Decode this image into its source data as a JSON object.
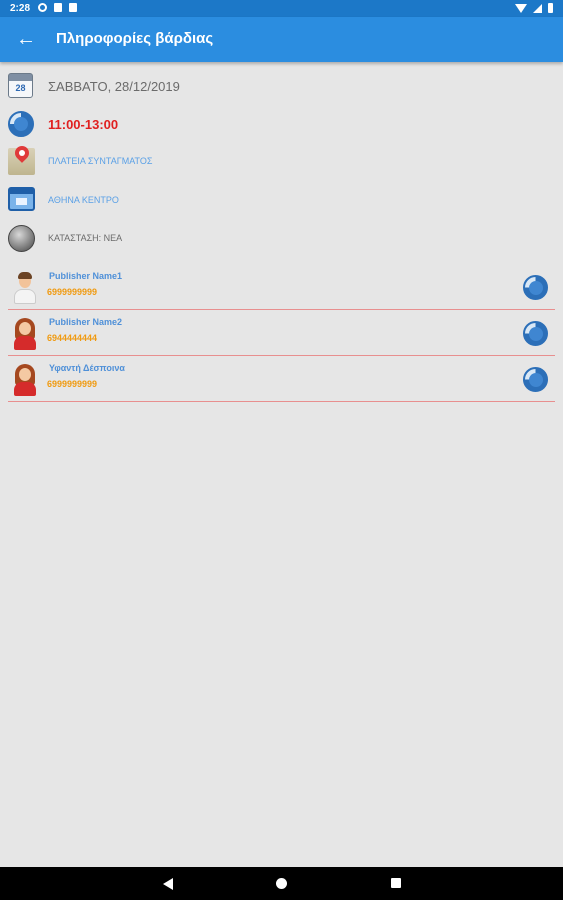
{
  "status_bar": {
    "time": "2:28",
    "icons": [
      "gear-icon",
      "sd-card-icon",
      "sd-card-icon",
      "wifi-icon",
      "signal-icon",
      "battery-icon"
    ]
  },
  "app_bar": {
    "back_icon": "arrow-left-icon",
    "title": "Πληροφορίες βάρδιας"
  },
  "shift": {
    "date": "ΣΑΒΒΑΤΟ, 28/12/2019",
    "time": "11:00-13:00",
    "location": "ΠΛΑΤΕΙΑ ΣΥΝΤΑΓΜΑΤΟΣ",
    "area": "ΑΘΗΝΑ ΚΕΝΤΡΟ",
    "status": "ΚΑΤΑΣΤΑΣΗ: ΝΕΑ"
  },
  "publishers": [
    {
      "name": "Publisher Name1",
      "phone": "6999999999",
      "avatar": "male-avatar-icon"
    },
    {
      "name": "Publisher Name2",
      "phone": "6944444444",
      "avatar": "female-avatar-icon"
    },
    {
      "name": "Υφαντή Δέσποινα",
      "phone": "6999999999",
      "avatar": "female-avatar-icon"
    }
  ],
  "colors": {
    "app_bar": "#2b8de0",
    "status_bar": "#1c78c8",
    "background": "#e6e6e6",
    "time_text": "#e02020",
    "phone_text": "#f09a10",
    "name_text": "#4f90d8",
    "divider": "#e88f8f"
  }
}
